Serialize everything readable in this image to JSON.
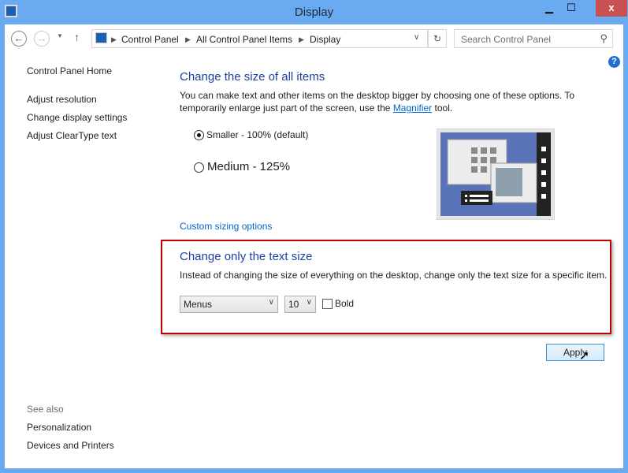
{
  "window": {
    "title": "Display",
    "minimize": "▁",
    "maximize": "☐",
    "close": "x"
  },
  "nav": {
    "breadcrumb": [
      "Control Panel",
      "All Control Panel Items",
      "Display"
    ],
    "search_placeholder": "Search Control Panel"
  },
  "sidebar": {
    "home": "Control Panel Home",
    "links": [
      "Adjust resolution",
      "Change display settings",
      "Adjust ClearType text"
    ],
    "see_also": "See also",
    "see_also_links": [
      "Personalization",
      "Devices and Printers"
    ]
  },
  "main": {
    "heading": "Change the size of all items",
    "desc_pre": "You can make text and other items on the desktop bigger by choosing one of these options. To temporarily enlarge just part of the screen, use the ",
    "desc_link": "Magnifier",
    "desc_post": " tool.",
    "options": [
      {
        "label": "Smaller - 100% (default)",
        "selected": true
      },
      {
        "label": "Medium - 125%",
        "selected": false
      }
    ],
    "custom_link": "Custom sizing options",
    "text_heading": "Change only the text size",
    "text_desc": "Instead of changing the size of everything on the desktop, change only the text size for a specific item.",
    "item_select": "Menus",
    "size_select": "10",
    "bold_label": "Bold",
    "bold_checked": false,
    "apply": "Apply"
  }
}
